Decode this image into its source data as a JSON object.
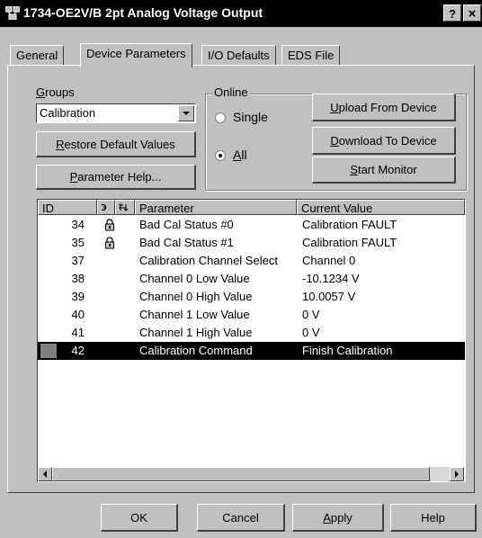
{
  "window": {
    "title": "1734-OE2V/B 2pt Analog Voltage Output",
    "help_button": "?",
    "close_button": "×"
  },
  "tabs": [
    {
      "label": "General",
      "active": false
    },
    {
      "label": "Device Parameters",
      "active": true
    },
    {
      "label": "I/O Defaults",
      "active": false
    },
    {
      "label": "EDS File",
      "active": false
    }
  ],
  "groups": {
    "label_first": "G",
    "label_rest": "roups",
    "selected": "Calibration"
  },
  "buttons": {
    "restore_first": "R",
    "restore_rest": "estore Default Values",
    "param_help_first": "P",
    "param_help_rest": "arameter Help...",
    "upload_first": "U",
    "upload_rest": "pload From Device",
    "download_first": "D",
    "download_rest": "ownload To Device",
    "start_first": "S",
    "start_rest": "tart Monitor"
  },
  "online": {
    "title": "Online",
    "single": "Single",
    "all_first": "A",
    "all_rest": "ll",
    "selected": "All"
  },
  "table": {
    "columns": [
      "ID",
      "Parameter",
      "Current Value"
    ],
    "rows": [
      {
        "id": "34",
        "locked": true,
        "parameter": "Bad Cal Status #0",
        "value": "Calibration FAULT",
        "selected": false
      },
      {
        "id": "35",
        "locked": true,
        "parameter": "Bad Cal Status #1",
        "value": "Calibration FAULT",
        "selected": false
      },
      {
        "id": "37",
        "locked": false,
        "parameter": "Calibration Channel Select",
        "value": "Channel 0",
        "selected": false
      },
      {
        "id": "38",
        "locked": false,
        "parameter": "Channel 0 Low Value",
        "value": "-10.1234 V",
        "selected": false
      },
      {
        "id": "39",
        "locked": false,
        "parameter": "Channel 0 High Value",
        "value": "10.0057 V",
        "selected": false
      },
      {
        "id": "40",
        "locked": false,
        "parameter": "Channel 1 Low Value",
        "value": "0 V",
        "selected": false
      },
      {
        "id": "41",
        "locked": false,
        "parameter": "Channel 1 High Value",
        "value": "0 V",
        "selected": false
      },
      {
        "id": "42",
        "locked": false,
        "parameter": "Calibration Command",
        "value": "Finish Calibration",
        "selected": true
      }
    ]
  },
  "footer": {
    "ok": "OK",
    "cancel": "Cancel",
    "apply_first": "A",
    "apply_rest": "pply",
    "help": "Help"
  }
}
